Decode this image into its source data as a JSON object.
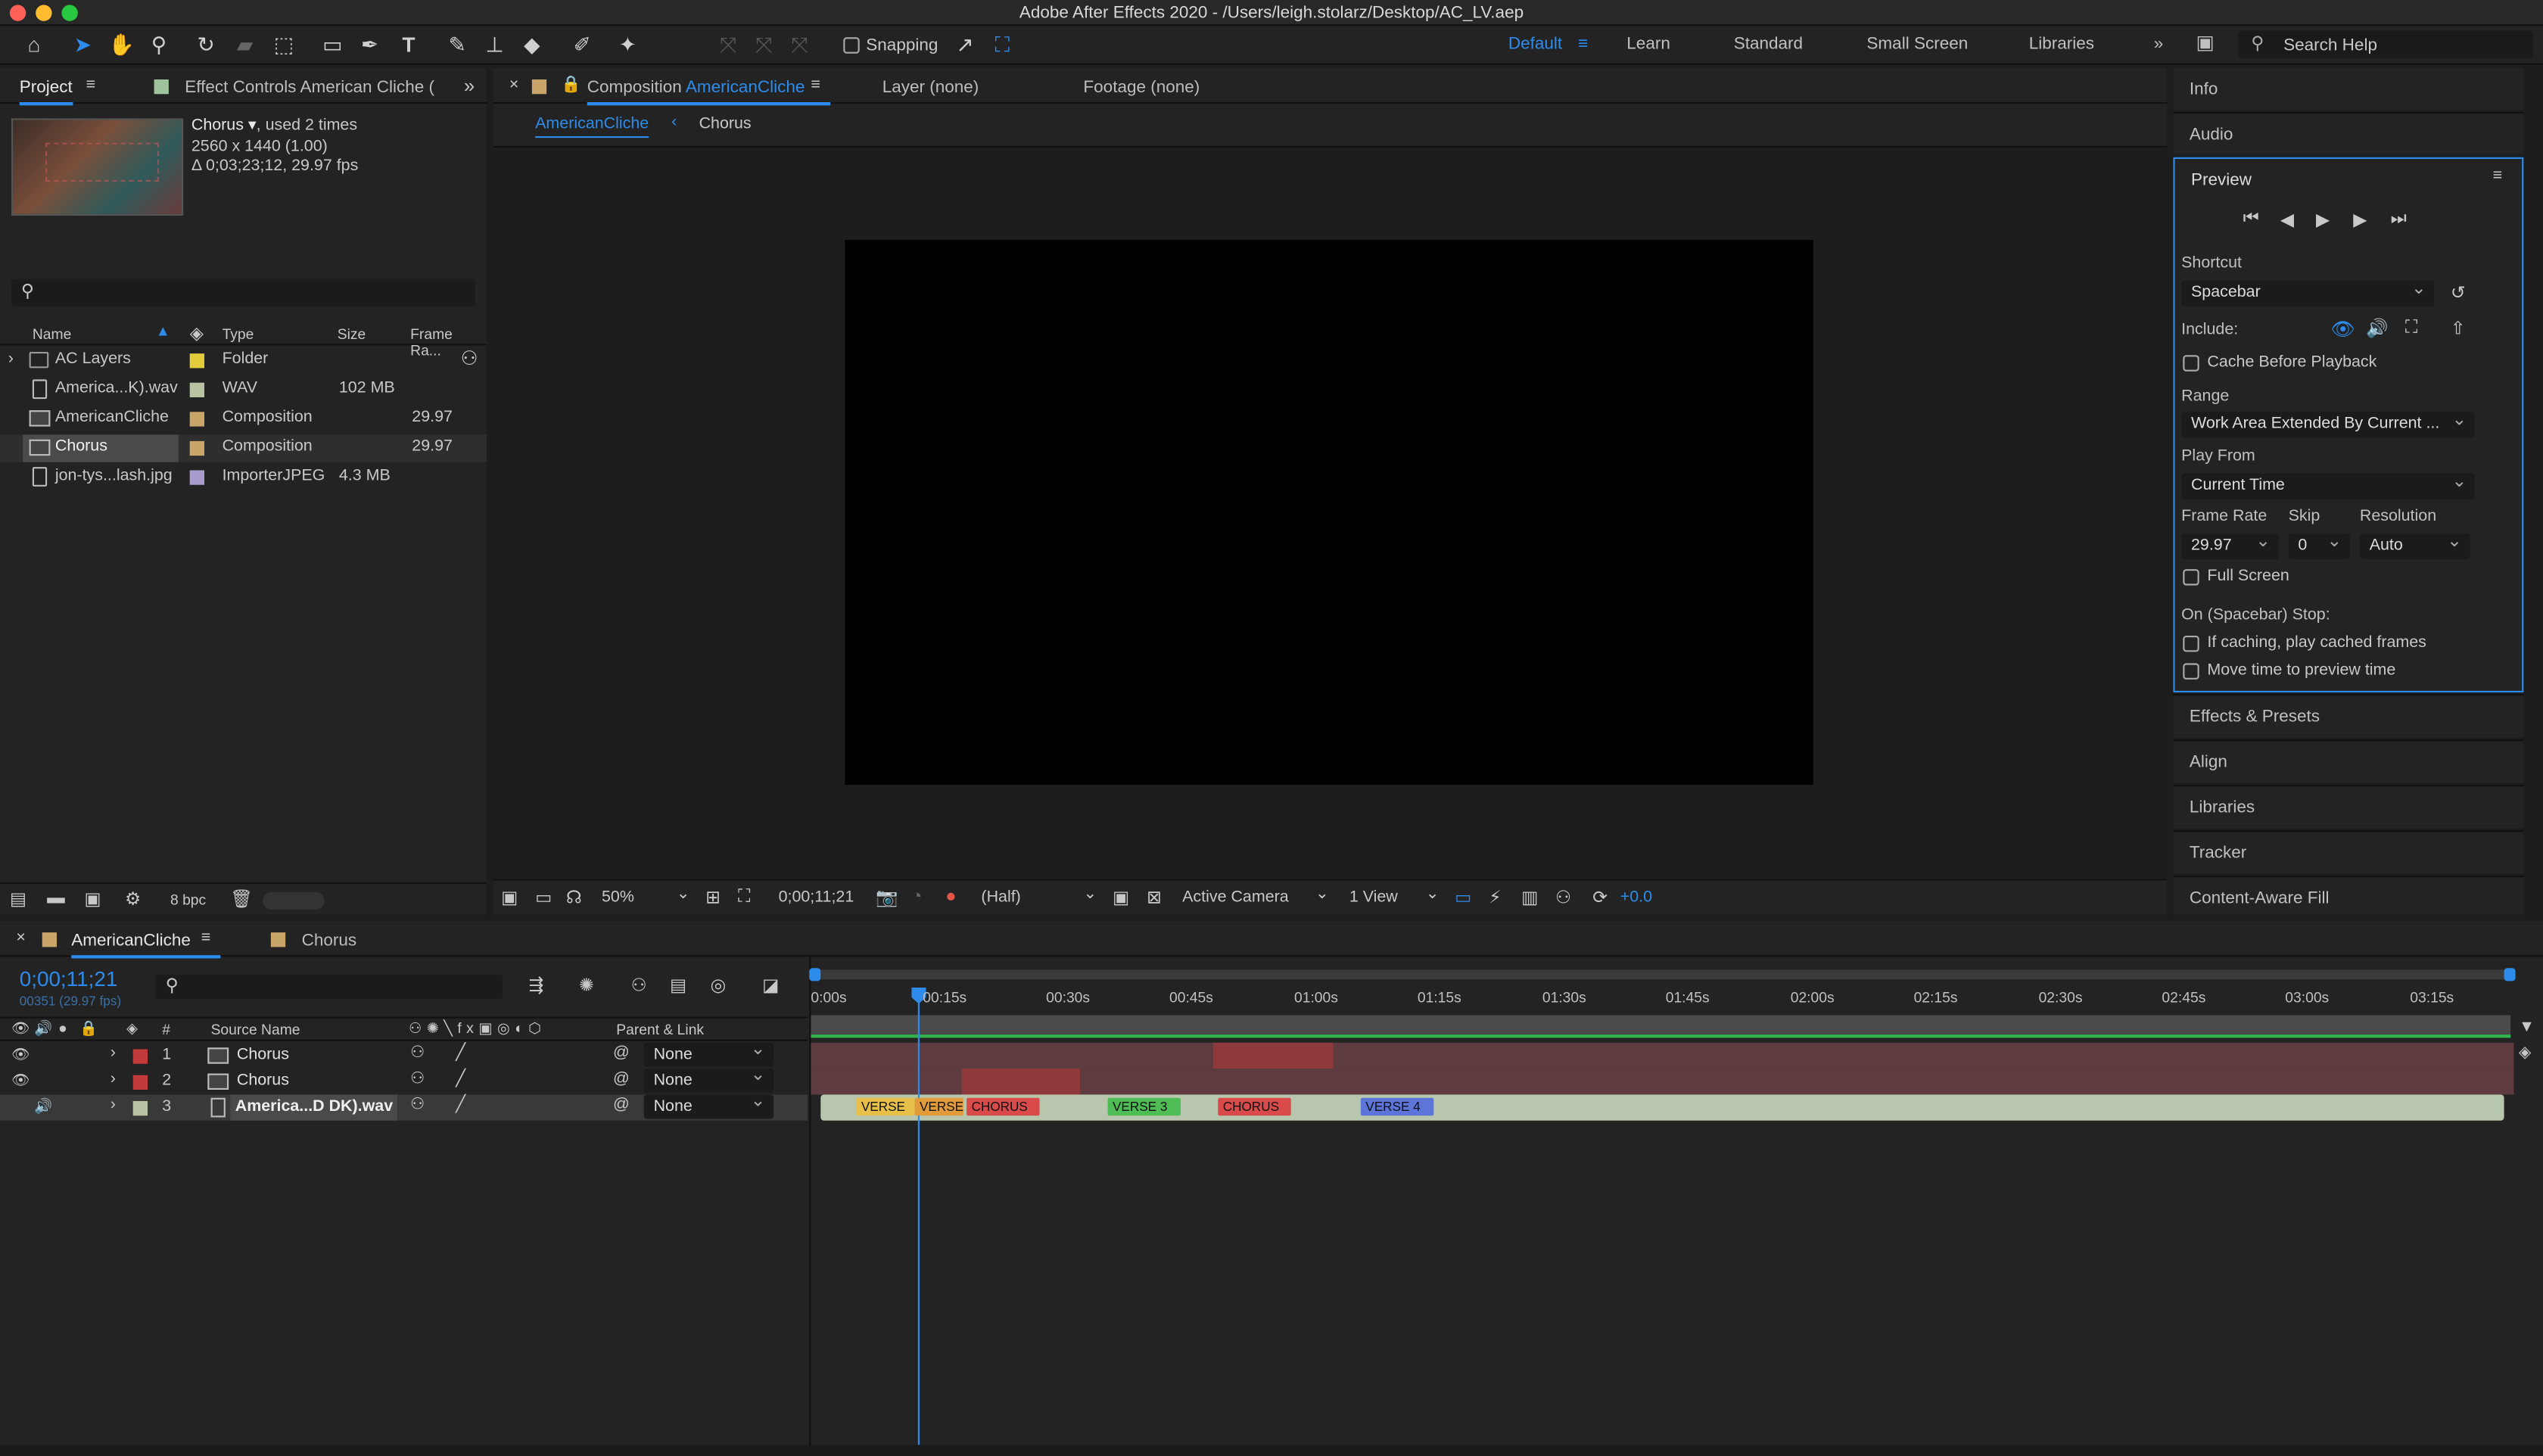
{
  "window": {
    "title": "Adobe After Effects 2020 - /Users/leigh.stolarz/Desktop/AC_LV.aep"
  },
  "toolbar": {
    "snapping": "Snapping",
    "workspaces": [
      "Default",
      "Learn",
      "Standard",
      "Small Screen",
      "Libraries"
    ],
    "search_placeholder": "Search Help"
  },
  "project_panel": {
    "tab_project": "Project",
    "tab_effects": "Effect Controls American Cliche (",
    "selected_name": "Chorus ▾",
    "used": ", used 2 times",
    "dims": "2560 x 1440 (1.00)",
    "duration": "Δ 0;03;23;12, 29.97 fps",
    "columns": [
      "Name",
      "Type",
      "Size",
      "Frame Ra..."
    ],
    "items": [
      {
        "name": "AC Layers",
        "type": "Folder",
        "size": "",
        "fps": "",
        "color": "#e2cc3a"
      },
      {
        "name": "America...K).wav",
        "type": "WAV",
        "size": "102 MB",
        "fps": "",
        "color": "#b7c3a3"
      },
      {
        "name": "AmericanCliche",
        "type": "Composition",
        "size": "",
        "fps": "29.97",
        "color": "#c9a56a"
      },
      {
        "name": "Chorus",
        "type": "Composition",
        "size": "",
        "fps": "29.97",
        "color": "#c9a56a"
      },
      {
        "name": "jon-tys...lash.jpg",
        "type": "ImporterJPEG",
        "size": "4.3 MB",
        "fps": "",
        "color": "#a99ccc"
      }
    ],
    "bpc": "8 bpc"
  },
  "comp_panel": {
    "tab_label": "Composition",
    "tab_comp": "AmericanCliche",
    "layer": "Layer (none)",
    "footage": "Footage (none)",
    "breadcrumb": [
      "AmericanCliche",
      "Chorus"
    ],
    "zoom": "50%",
    "timecode": "0;00;11;21",
    "resolution": "(Half)",
    "camera": "Active Camera",
    "views": "1 View",
    "exposure": "+0.0"
  },
  "right_panel": {
    "info": "Info",
    "audio": "Audio",
    "preview": "Preview",
    "shortcut_label": "Shortcut",
    "shortcut": "Spacebar",
    "include": "Include:",
    "cache_before": "Cache Before Playback",
    "range_label": "Range",
    "range": "Work Area Extended By Current ...",
    "play_from_label": "Play From",
    "play_from": "Current Time",
    "frame_rate_label": "Frame Rate",
    "skip_label": "Skip",
    "resolution_label": "Resolution",
    "frame_rate": "29.97",
    "skip": "0",
    "resolution": "Auto",
    "full_screen": "Full Screen",
    "on_stop": "On (Spacebar) Stop:",
    "if_caching": "If caching, play cached frames",
    "move_time": "Move time to preview time",
    "panels": [
      "Effects & Presets",
      "Align",
      "Libraries",
      "Tracker",
      "Content-Aware Fill"
    ]
  },
  "timeline": {
    "tabs": [
      "AmericanCliche",
      "Chorus"
    ],
    "timecode": "0;00;11;21",
    "frame_info": "00351 (29.97 fps)",
    "col_source": "Source Name",
    "col_parent": "Parent & Link",
    "layers": [
      {
        "num": "1",
        "name": "Chorus",
        "parent": "None",
        "color": "#c23a3a"
      },
      {
        "num": "2",
        "name": "Chorus",
        "parent": "None",
        "color": "#c23a3a"
      },
      {
        "num": "3",
        "name": "America...D DK).wav",
        "parent": "None",
        "color": "#b7c3a3"
      }
    ],
    "ticks": [
      "0:00s",
      "00:15s",
      "00:30s",
      "00:45s",
      "01:00s",
      "01:15s",
      "01:30s",
      "01:45s",
      "02:00s",
      "02:15s",
      "02:30s",
      "02:45s",
      "03:00s",
      "03:15s"
    ],
    "markers": [
      {
        "label": "VERSE",
        "color": "#e7c04a"
      },
      {
        "label": "VERSE",
        "color": "#e29b3a"
      },
      {
        "label": "CHORUS",
        "color": "#d94a4a"
      },
      {
        "label": "VERSE 3",
        "color": "#4fbd55"
      },
      {
        "label": "CHORUS",
        "color": "#d94a4a"
      },
      {
        "label": "VERSE 4",
        "color": "#5d74d8"
      }
    ]
  }
}
